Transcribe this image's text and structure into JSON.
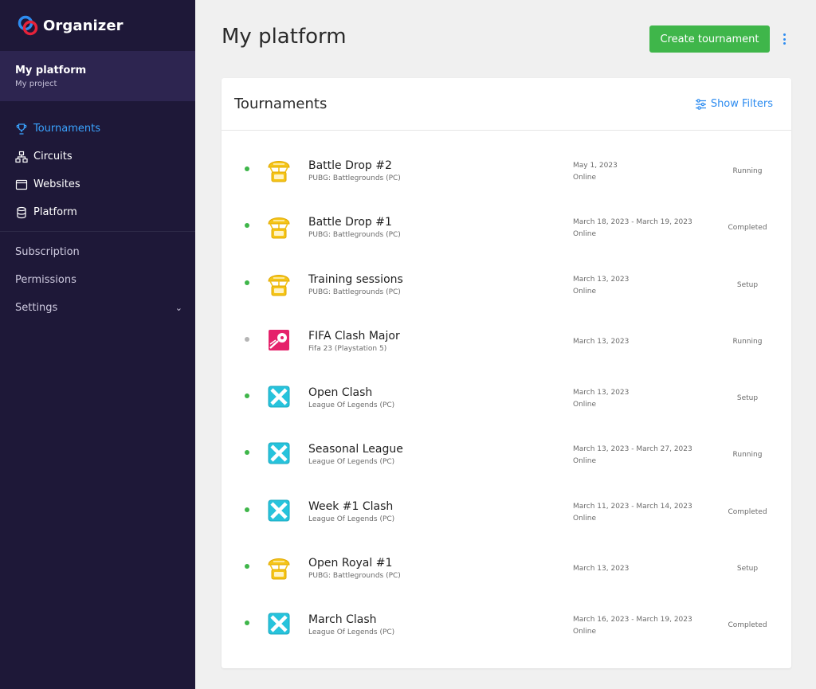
{
  "app": {
    "name": "Organizer"
  },
  "project": {
    "name": "My platform",
    "subtitle": "My project"
  },
  "nav": {
    "items": [
      {
        "label": "Tournaments",
        "icon": "trophy-icon",
        "active": true
      },
      {
        "label": "Circuits",
        "icon": "circuit-icon",
        "active": false
      },
      {
        "label": "Websites",
        "icon": "browser-window-icon",
        "active": false
      },
      {
        "label": "Platform",
        "icon": "database-icon",
        "active": false
      }
    ],
    "secondary": [
      {
        "label": "Subscription"
      },
      {
        "label": "Permissions"
      },
      {
        "label": "Settings"
      }
    ]
  },
  "header": {
    "title": "My platform",
    "create_label": "Create tournament"
  },
  "card": {
    "title": "Tournaments",
    "filters_label": "Show Filters"
  },
  "colors": {
    "accent": "#2d8cf0",
    "success": "#3fb64a",
    "sidebar": "#1e1838",
    "sidebar_project": "#2d2550",
    "pubg": "#f5c518",
    "lol": "#27c3dc",
    "fifa": "#e5226b"
  },
  "tournaments": [
    {
      "name": "Battle Drop #2",
      "game": "PUBG: Battlegrounds (PC)",
      "game_icon": "pubg-icon",
      "date": "May 1, 2023",
      "location": "Online",
      "status": "Running",
      "dot": "green"
    },
    {
      "name": "Battle Drop #1",
      "game": "PUBG: Battlegrounds (PC)",
      "game_icon": "pubg-icon",
      "date": "March 18, 2023 - March 19, 2023",
      "location": "Online",
      "status": "Completed",
      "dot": "green"
    },
    {
      "name": "Training sessions",
      "game": "PUBG: Battlegrounds (PC)",
      "game_icon": "pubg-icon",
      "date": "March 13, 2023",
      "location": "Online",
      "status": "Setup",
      "dot": "green"
    },
    {
      "name": "FIFA Clash Major",
      "game": "Fifa 23 (Playstation 5)",
      "game_icon": "fifa-icon",
      "date": "March 13, 2023",
      "location": "",
      "status": "Running",
      "dot": "grey"
    },
    {
      "name": "Open Clash",
      "game": "League Of Legends (PC)",
      "game_icon": "lol-icon",
      "date": "March 13, 2023",
      "location": "Online",
      "status": "Setup",
      "dot": "green"
    },
    {
      "name": "Seasonal League",
      "game": "League Of Legends (PC)",
      "game_icon": "lol-icon",
      "date": "March 13, 2023 - March 27, 2023",
      "location": "Online",
      "status": "Running",
      "dot": "green"
    },
    {
      "name": "Week #1 Clash",
      "game": "League Of Legends (PC)",
      "game_icon": "lol-icon",
      "date": "March 11, 2023 - March 14, 2023",
      "location": "Online",
      "status": "Completed",
      "dot": "green"
    },
    {
      "name": "Open Royal #1",
      "game": "PUBG: Battlegrounds (PC)",
      "game_icon": "pubg-icon",
      "date": "March 13, 2023",
      "location": "",
      "status": "Setup",
      "dot": "green"
    },
    {
      "name": "March Clash",
      "game": "League Of Legends (PC)",
      "game_icon": "lol-icon",
      "date": "March 16, 2023 - March 19, 2023",
      "location": "Online",
      "status": "Completed",
      "dot": "green"
    }
  ]
}
